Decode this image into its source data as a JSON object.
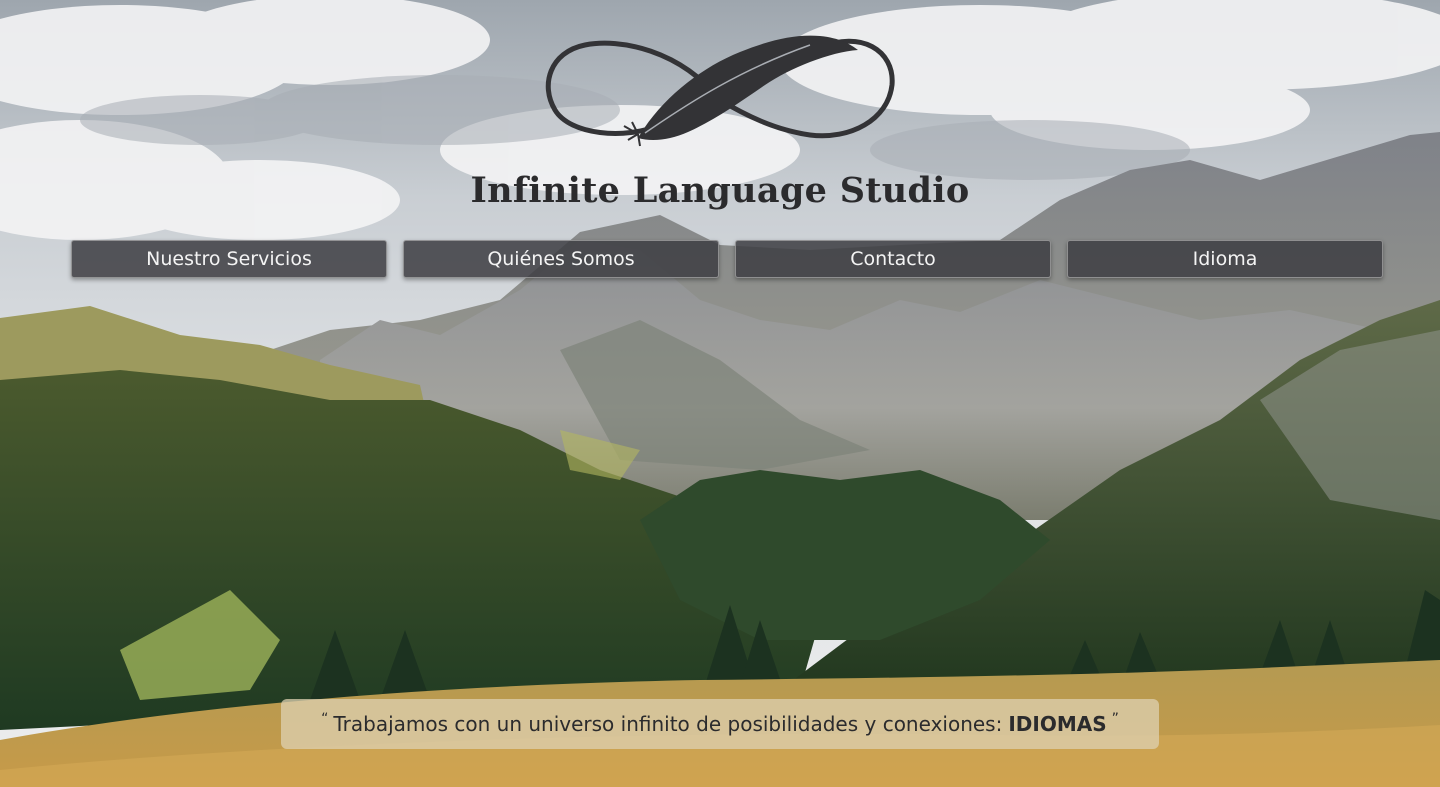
{
  "site": {
    "brand": "Infinite Language Studio",
    "logo_icon": "infinity-feather-icon"
  },
  "nav": {
    "items": [
      {
        "label": "Nuestro Servicios"
      },
      {
        "label": "Quiénes Somos"
      },
      {
        "label": "Contacto"
      },
      {
        "label": "Idioma"
      }
    ]
  },
  "hero": {
    "background_icon": "alpine-landscape-image",
    "tagline": {
      "open_quote": "“",
      "text": "Trabajamos con un universo infinito de posibilidades y conexiones:",
      "highlight": "IDIOMAS",
      "close_quote": "”"
    }
  },
  "colors": {
    "button_bg": "#3e3e42",
    "brand_text": "#2b2b2d",
    "tagline_bg": "#ded0b2"
  }
}
